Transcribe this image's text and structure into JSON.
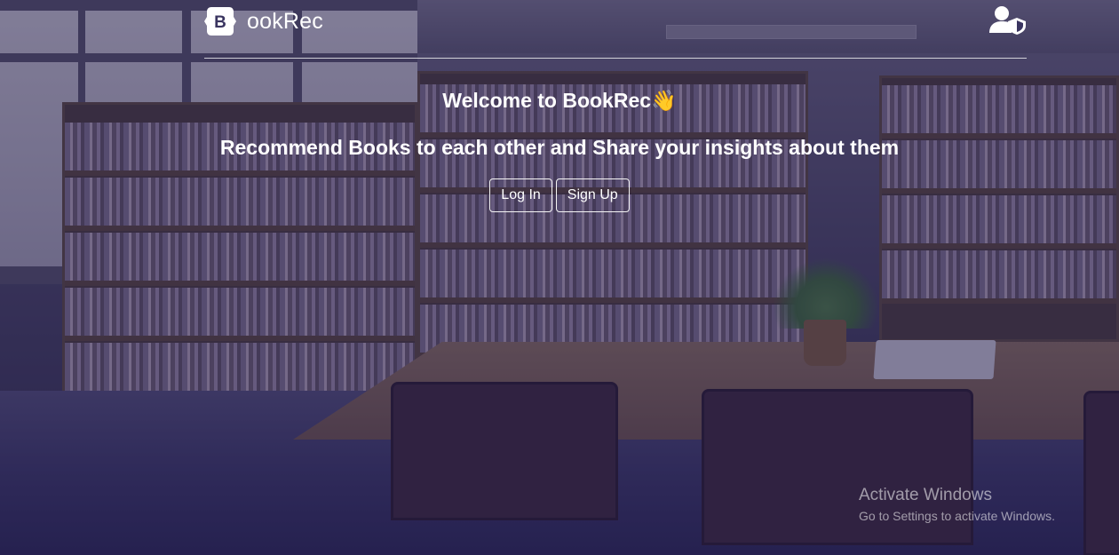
{
  "header": {
    "brand_letter": "B",
    "brand_text": "ookRec",
    "user_icon": "user-shield-icon"
  },
  "hero": {
    "welcome": "Welcome to BookRec👋",
    "tagline": "Recommend Books to each other and Share your insights about them",
    "login_label": "Log In",
    "signup_label": "Sign Up"
  },
  "watermark": {
    "title": "Activate Windows",
    "subtitle": "Go to Settings to activate Windows."
  },
  "colors": {
    "text": "#ffffff",
    "overlay": "#1e1846"
  }
}
